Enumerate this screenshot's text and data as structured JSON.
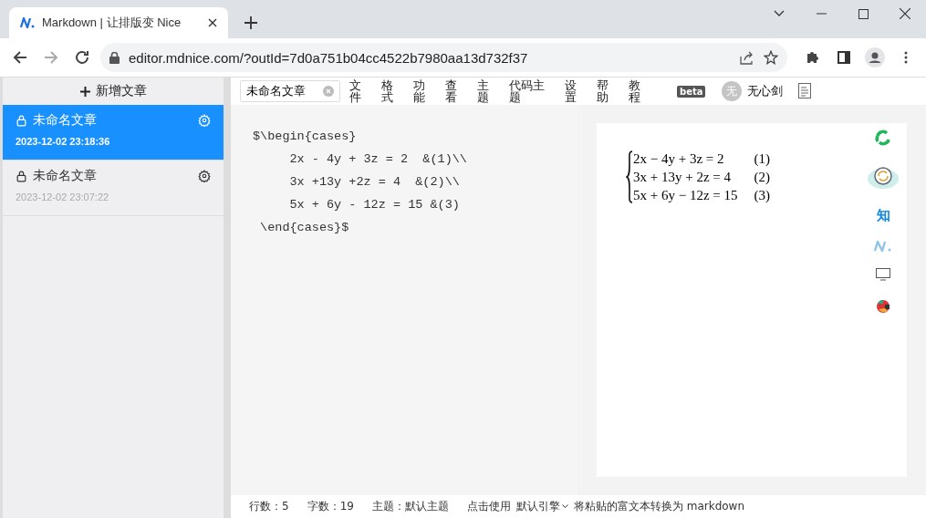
{
  "browser": {
    "tab_title": "Markdown | 让排版变 Nice",
    "url": "editor.mdnice.com/?outId=7d0a751b04cc4522b7980aa13d732f37"
  },
  "sidebar": {
    "new_button": "新增文章",
    "articles": [
      {
        "title": "未命名文章",
        "date": "2023-12-02 23:18:36",
        "selected": true
      },
      {
        "title": "未命名文章",
        "date": "2023-12-02 23:07:22",
        "selected": false
      }
    ]
  },
  "toolbar": {
    "doc_tab": "未命名文章",
    "menus": [
      {
        "lines": [
          "文",
          "件"
        ]
      },
      {
        "lines": [
          "格",
          "式"
        ]
      },
      {
        "lines": [
          "功",
          "能"
        ]
      },
      {
        "lines": [
          "查",
          "看"
        ]
      },
      {
        "lines": [
          "主",
          "题"
        ]
      },
      {
        "lines": [
          "代码主",
          "题"
        ]
      },
      {
        "lines": [
          "设",
          "置"
        ]
      },
      {
        "lines": [
          "帮",
          "助"
        ]
      },
      {
        "lines": [
          "教",
          "程"
        ]
      }
    ],
    "badge": "beta",
    "avatar": "无",
    "user": "无心剑"
  },
  "editor": {
    "lines": [
      "$\\begin{cases}",
      "     2x - 4y + 3z = 2  &(1)\\\\",
      "     3x +13y +2z = 4  &(2)\\\\",
      "     5x + 6y - 12z = 15 &(3)",
      " \\end{cases}$"
    ]
  },
  "preview": {
    "equations": [
      {
        "equation": "2x − 4y + 3z = 2",
        "tag": "(1)"
      },
      {
        "equation": "3x + 13y + 2z = 4",
        "tag": "(2)"
      },
      {
        "equation": "5x + 6y − 12z = 15",
        "tag": "(3)"
      }
    ],
    "side_text": "知"
  },
  "status_bar": {
    "lines": "行数：5",
    "chars": "字数：19",
    "theme": "主题：默认主题",
    "use_label": "点击使用",
    "engine": "默认引擎",
    "convert": "将粘贴的富文本转换为 markdown"
  }
}
